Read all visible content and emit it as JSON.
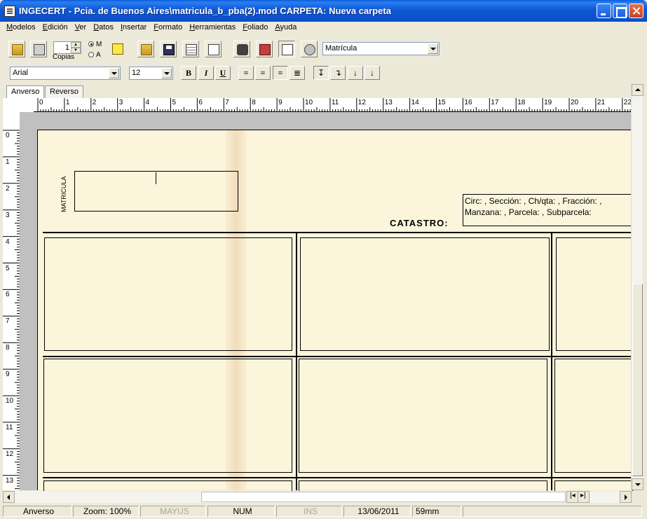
{
  "window": {
    "title": "INGECERT - Pcia. de Buenos Aires\\matricula_b_pba(2).mod   CARPETA: Nueva carpeta"
  },
  "menu": [
    "Modelos",
    "Edición",
    "Ver",
    "Datos",
    "Insertar",
    "Formato",
    "Herramientas",
    "Foliado",
    "Ayuda"
  ],
  "toolbar": {
    "copies_value": "1",
    "copies_label": "Copias",
    "radio_m": "M",
    "radio_a": "A",
    "model_select": "Matrícula",
    "font_select": "Arial",
    "size_select": "12",
    "bold": "B",
    "italic": "I",
    "underline": "U",
    "icons": [
      "open-icon",
      "print-icon",
      "ruler-icon",
      "open-folder-icon",
      "save-icon",
      "printer-settings-icon",
      "new-document-icon",
      "camera-icon",
      "package-icon",
      "chart-icon",
      "settings-icon"
    ]
  },
  "tabs": [
    "Anverso",
    "Reverso"
  ],
  "ruler": {
    "h": [
      "0",
      "1",
      "2",
      "3",
      "4",
      "5",
      "6",
      "7",
      "8",
      "9",
      "10",
      "11",
      "12",
      "13",
      "14",
      "15",
      "16",
      "17",
      "18",
      "19",
      "20",
      "21",
      "22"
    ],
    "v": [
      "0",
      "1",
      "2",
      "3",
      "4",
      "5",
      "6",
      "7",
      "8",
      "9",
      "10",
      "11",
      "12",
      "13"
    ]
  },
  "document": {
    "matricula_label": "MATRICULA",
    "catastro_label": "CATASTRO:",
    "catastro_line1": "Circ: , Sección: , Ch/qta: , Fracción: ,",
    "catastro_line2": "Manzana: , Parcela: , Subparcela:"
  },
  "status": {
    "side": "Anverso",
    "zoom": "Zoom:  100%",
    "mayus": "MAYUS",
    "num": "NUM",
    "ins": "INS",
    "date": "13/06/2011",
    "position": "59mm"
  }
}
